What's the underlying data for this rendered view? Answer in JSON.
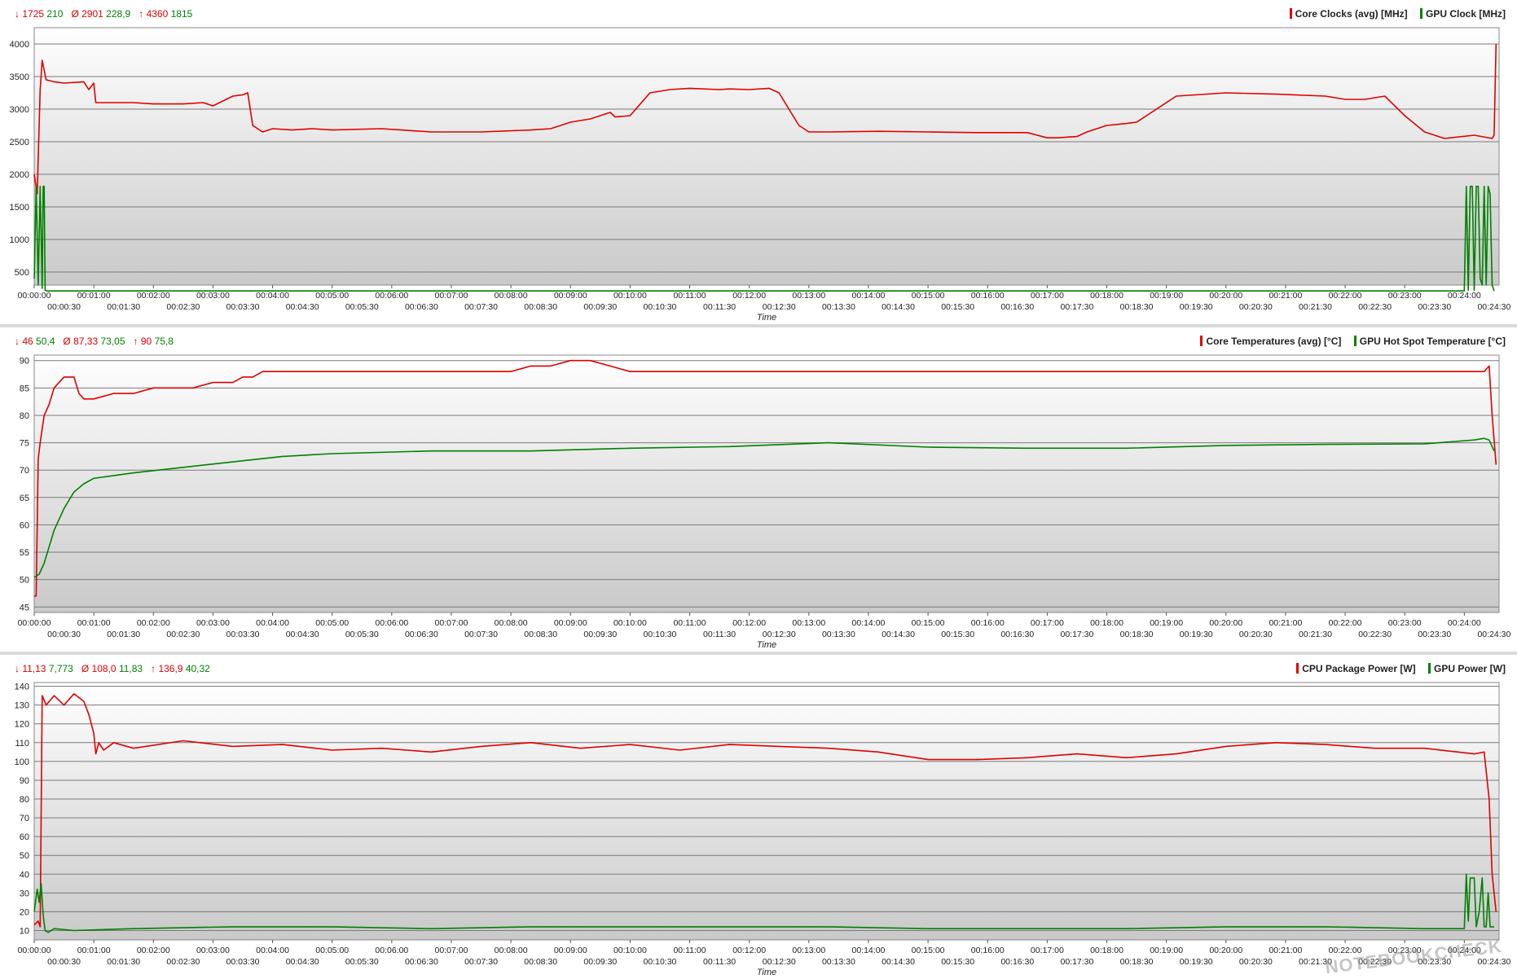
{
  "charts": [
    {
      "stats": {
        "min_label": "↓",
        "min_red": "1725",
        "min_green": "210",
        "avg_label": "Ø",
        "avg_red": "2901",
        "avg_green": "228,9",
        "max_label": "↑",
        "max_red": "4360",
        "max_green": "1815"
      },
      "legend": {
        "red": "Core Clocks (avg) [MHz]",
        "green": "GPU Clock [MHz]"
      },
      "y_ticks": [
        "500",
        "1000",
        "1500",
        "2000",
        "2500",
        "3000",
        "3500",
        "4000"
      ],
      "x_label": "Time"
    },
    {
      "stats": {
        "min_label": "↓",
        "min_red": "46",
        "min_green": "50,4",
        "avg_label": "Ø",
        "avg_red": "87,33",
        "avg_green": "73,05",
        "max_label": "↑",
        "max_red": "90",
        "max_green": "75,8"
      },
      "legend": {
        "red": "Core Temperatures (avg) [°C]",
        "green": "GPU Hot Spot Temperature [°C]"
      },
      "y_ticks": [
        "45",
        "50",
        "55",
        "60",
        "65",
        "70",
        "75",
        "80",
        "85",
        "90"
      ],
      "x_label": "Time"
    },
    {
      "stats": {
        "min_label": "↓",
        "min_red": "11,13",
        "min_green": "7,773",
        "avg_label": "Ø",
        "avg_red": "108,0",
        "avg_green": "11,83",
        "max_label": "↑",
        "max_red": "136,9",
        "max_green": "40,32"
      },
      "legend": {
        "red": "CPU Package Power [W]",
        "green": "GPU Power [W]"
      },
      "y_ticks": [
        "10",
        "20",
        "30",
        "40",
        "50",
        "60",
        "70",
        "80",
        "90",
        "100",
        "110",
        "120",
        "130",
        "140"
      ],
      "x_label": "Time"
    }
  ],
  "x_ticks_upper": [
    "00:00:00",
    "00:01:00",
    "00:02:00",
    "00:03:00",
    "00:04:00",
    "00:05:00",
    "00:06:00",
    "00:07:00",
    "00:08:00",
    "00:09:00",
    "00:10:00",
    "00:11:00",
    "00:12:00",
    "00:13:00",
    "00:14:00",
    "00:15:00",
    "00:16:00",
    "00:17:00",
    "00:18:00",
    "00:19:00",
    "00:20:00",
    "00:21:00",
    "00:22:00",
    "00:23:00",
    "00:24:00"
  ],
  "x_ticks_lower": [
    "00:00:30",
    "00:01:30",
    "00:02:30",
    "00:03:30",
    "00:04:30",
    "00:05:30",
    "00:06:30",
    "00:07:30",
    "00:08:30",
    "00:09:30",
    "00:10:30",
    "00:11:30",
    "00:12:30",
    "00:13:30",
    "00:14:30",
    "00:15:30",
    "00:16:30",
    "00:17:30",
    "00:18:30",
    "00:19:30",
    "00:20:30",
    "00:21:30",
    "00:22:30",
    "00:23:30",
    "00:24:30"
  ],
  "colors": {
    "red": "#e00000",
    "green": "#008000",
    "grid": "#7a7a7a"
  },
  "watermark": "NOTEBOOKCHECK",
  "chart_data": [
    {
      "type": "line",
      "xlabel": "Time",
      "ylabel": "",
      "x_unit": "seconds",
      "xlim": [
        0,
        1475
      ],
      "ylim": [
        300,
        4250
      ],
      "grid": true,
      "legend_position": "top-right",
      "series": [
        {
          "name": "Core Clocks (avg) [MHz]",
          "color": "#e00000",
          "x": [
            0,
            3,
            6,
            8,
            12,
            20,
            30,
            50,
            55,
            60,
            62,
            65,
            100,
            120,
            150,
            170,
            180,
            200,
            210,
            215,
            220,
            230,
            240,
            260,
            280,
            300,
            350,
            400,
            450,
            500,
            520,
            540,
            560,
            570,
            580,
            585,
            600,
            620,
            640,
            660,
            690,
            700,
            720,
            740,
            750,
            760,
            770,
            780,
            800,
            850,
            900,
            950,
            1000,
            1020,
            1030,
            1050,
            1060,
            1080,
            1100,
            1110,
            1120,
            1150,
            1200,
            1250,
            1300,
            1320,
            1340,
            1360,
            1380,
            1400,
            1420,
            1450,
            1468,
            1470,
            1472
          ],
          "y": [
            2000,
            1700,
            3300,
            3750,
            3450,
            3420,
            3400,
            3420,
            3300,
            3400,
            3100,
            3100,
            3100,
            3080,
            3080,
            3100,
            3050,
            3200,
            3220,
            3250,
            2750,
            2650,
            2700,
            2680,
            2700,
            2680,
            2700,
            2650,
            2650,
            2680,
            2700,
            2800,
            2850,
            2900,
            2950,
            2880,
            2900,
            3250,
            3300,
            3320,
            3300,
            3310,
            3300,
            3320,
            3250,
            3000,
            2750,
            2650,
            2650,
            2660,
            2650,
            2640,
            2640,
            2560,
            2560,
            2580,
            2650,
            2750,
            2780,
            2800,
            2900,
            3200,
            3250,
            3230,
            3200,
            3150,
            3150,
            3200,
            2900,
            2650,
            2550,
            2600,
            2550,
            2600,
            4000
          ]
        },
        {
          "name": "GPU Clock [MHz]",
          "color": "#008000",
          "x": [
            0,
            2,
            4,
            6,
            8,
            9,
            10,
            11,
            13,
            20,
            100,
            500,
            1000,
            1420,
            1440,
            1442,
            1444,
            1446,
            1448,
            1450,
            1452,
            1454,
            1456,
            1458,
            1460,
            1462,
            1464,
            1466,
            1468,
            1470
          ],
          "y": [
            400,
            1815,
            300,
            1815,
            250,
            1815,
            1815,
            220,
            210,
            210,
            210,
            210,
            210,
            210,
            210,
            1815,
            220,
            1815,
            1815,
            220,
            1815,
            1815,
            400,
            300,
            1815,
            300,
            1815,
            1700,
            300,
            210
          ]
        }
      ]
    },
    {
      "type": "line",
      "xlabel": "Time",
      "ylabel": "",
      "x_unit": "seconds",
      "xlim": [
        0,
        1475
      ],
      "ylim": [
        44,
        91
      ],
      "grid": true,
      "legend_position": "top-right",
      "series": [
        {
          "name": "Core Temperatures (avg) [°C]",
          "color": "#e00000",
          "x": [
            0,
            2,
            4,
            6,
            10,
            15,
            20,
            25,
            30,
            40,
            45,
            50,
            52,
            55,
            60,
            80,
            100,
            120,
            140,
            160,
            180,
            200,
            210,
            220,
            230,
            240,
            300,
            400,
            480,
            500,
            520,
            540,
            560,
            580,
            600,
            700,
            800,
            900,
            1000,
            1100,
            1200,
            1300,
            1400,
            1460,
            1465,
            1468,
            1472
          ],
          "y": [
            47,
            47,
            72,
            75,
            80,
            82,
            85,
            86,
            87,
            87,
            84,
            83,
            83,
            83,
            83,
            84,
            84,
            85,
            85,
            85,
            86,
            86,
            87,
            87,
            88,
            88,
            88,
            88,
            88,
            89,
            89,
            90,
            90,
            89,
            88,
            88,
            88,
            88,
            88,
            88,
            88,
            88,
            88,
            88,
            89,
            80,
            71
          ]
        },
        {
          "name": "GPU Hot Spot Temperature [°C]",
          "color": "#008000",
          "x": [
            0,
            5,
            10,
            15,
            20,
            30,
            40,
            50,
            60,
            80,
            100,
            150,
            200,
            250,
            300,
            400,
            500,
            600,
            700,
            800,
            900,
            1000,
            1100,
            1200,
            1300,
            1400,
            1450,
            1460,
            1465,
            1470
          ],
          "y": [
            50.4,
            51,
            53,
            56,
            59,
            63,
            66,
            67.5,
            68.5,
            69,
            69.5,
            70.5,
            71.5,
            72.5,
            73,
            73.5,
            73.5,
            74,
            74.3,
            75,
            74.2,
            74,
            74,
            74.5,
            74.7,
            74.8,
            75.5,
            75.8,
            75.5,
            73.5
          ]
        }
      ]
    },
    {
      "type": "line",
      "xlabel": "Time",
      "ylabel": "",
      "x_unit": "seconds",
      "xlim": [
        0,
        1475
      ],
      "ylim": [
        5,
        142
      ],
      "grid": true,
      "legend_position": "top-right",
      "series": [
        {
          "name": "CPU Package Power [W]",
          "color": "#e00000",
          "x": [
            0,
            4,
            6,
            8,
            12,
            20,
            30,
            40,
            50,
            55,
            60,
            62,
            65,
            70,
            80,
            100,
            150,
            200,
            250,
            300,
            350,
            400,
            450,
            500,
            550,
            600,
            650,
            700,
            750,
            800,
            850,
            900,
            950,
            1000,
            1050,
            1100,
            1150,
            1200,
            1250,
            1300,
            1350,
            1400,
            1450,
            1460,
            1465,
            1468,
            1472
          ],
          "y": [
            13,
            15,
            12,
            135,
            130,
            135,
            130,
            136,
            132,
            125,
            115,
            104,
            110,
            106,
            110,
            107,
            111,
            108,
            109,
            106,
            107,
            105,
            108,
            110,
            107,
            109,
            106,
            109,
            108,
            107,
            105,
            101,
            101,
            102,
            104,
            102,
            104,
            108,
            110,
            109,
            107,
            107,
            104,
            105,
            80,
            40,
            20
          ]
        },
        {
          "name": "GPU Power [W]",
          "color": "#008000",
          "x": [
            0,
            3,
            5,
            7,
            9,
            11,
            14,
            20,
            40,
            100,
            200,
            300,
            400,
            500,
            600,
            700,
            800,
            900,
            1000,
            1100,
            1200,
            1300,
            1400,
            1440,
            1442,
            1444,
            1446,
            1450,
            1452,
            1455,
            1458,
            1460,
            1462,
            1464,
            1466,
            1470
          ],
          "y": [
            20,
            32,
            25,
            35,
            18,
            10,
            9,
            11,
            10,
            11,
            12,
            12,
            11,
            12,
            12,
            12,
            12,
            11,
            11,
            11,
            12,
            12,
            11,
            11,
            40,
            15,
            38,
            38,
            12,
            20,
            38,
            12,
            12,
            30,
            12,
            12
          ]
        }
      ]
    }
  ]
}
